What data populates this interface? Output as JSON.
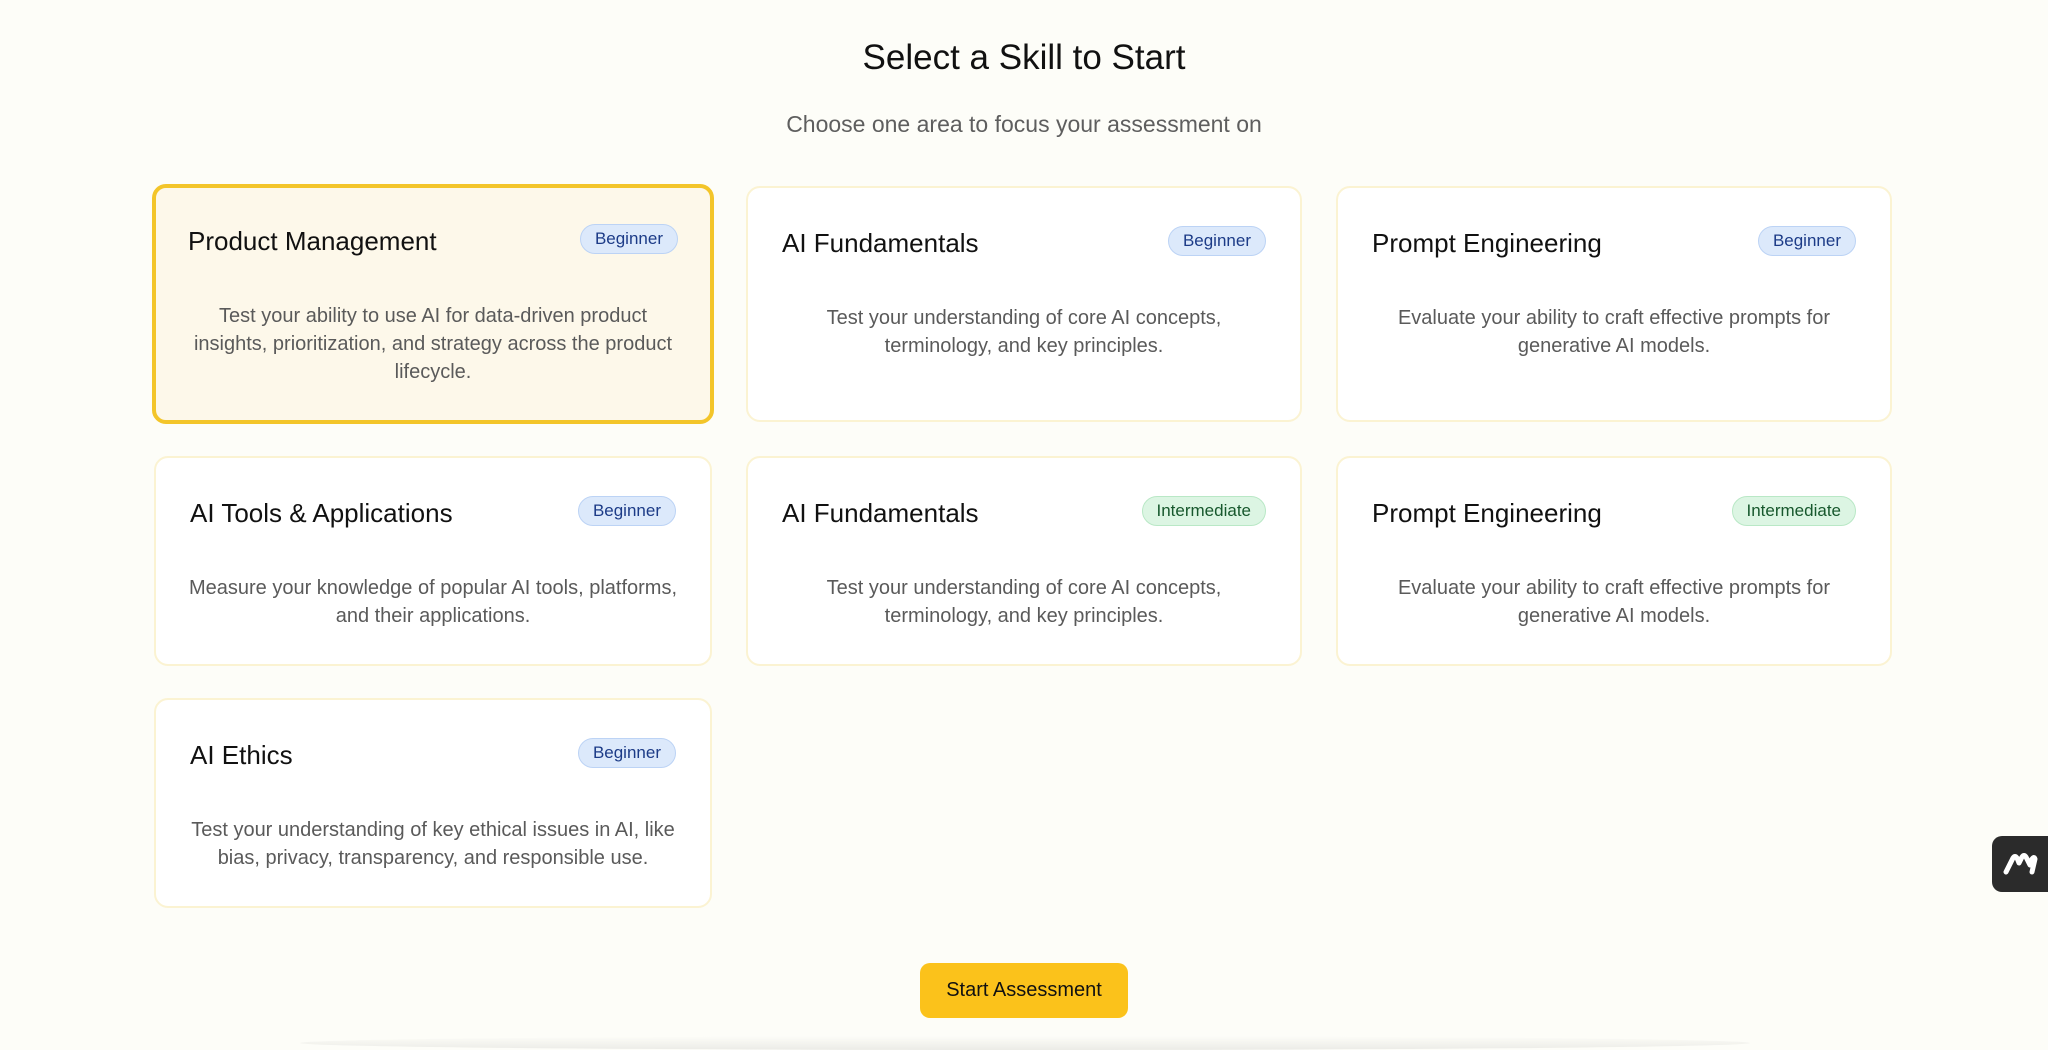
{
  "header": {
    "title": "Select a Skill to Start",
    "subtitle": "Choose one area to focus your assessment on"
  },
  "skills": [
    {
      "title": "Product Management",
      "level": "Beginner",
      "description": "Test your ability to use AI for data-driven product insights, prioritization, and strategy across the product lifecycle.",
      "selected": true
    },
    {
      "title": "AI Fundamentals",
      "level": "Beginner",
      "description": "Test your understanding of core AI concepts, terminology, and key principles.",
      "selected": false
    },
    {
      "title": "Prompt Engineering",
      "level": "Beginner",
      "description": "Evaluate your ability to craft effective prompts for generative AI models.",
      "selected": false
    },
    {
      "title": "AI Tools & Applications",
      "level": "Beginner",
      "description": "Measure your knowledge of popular AI tools, platforms, and their applications.",
      "selected": false
    },
    {
      "title": "AI Fundamentals",
      "level": "Intermediate",
      "description": "Test your understanding of core AI concepts, terminology, and key principles.",
      "selected": false
    },
    {
      "title": "Prompt Engineering",
      "level": "Intermediate",
      "description": "Evaluate your ability to craft effective prompts for generative AI models.",
      "selected": false
    },
    {
      "title": "AI Ethics",
      "level": "Beginner",
      "description": "Test your understanding of key ethical issues in AI, like bias, privacy, transparency, and responsible use.",
      "selected": false
    }
  ],
  "actions": {
    "start_label": "Start Assessment"
  },
  "widget": {
    "icon": "logo-m-icon"
  },
  "colors": {
    "accent": "#fbc21b",
    "selected_border": "#f3c52a",
    "beginner_badge": "#dce9fb",
    "intermediate_badge": "#dcf5e3"
  }
}
